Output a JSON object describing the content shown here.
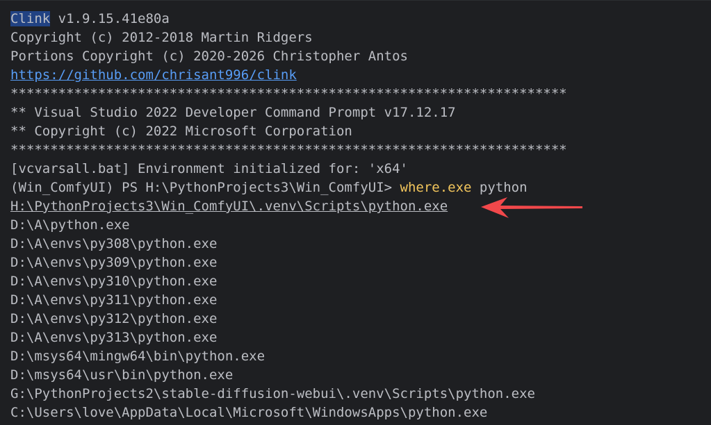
{
  "terminal": {
    "banner": {
      "clink_name": "Clink",
      "clink_version": " v1.9.15.41e80a",
      "copyright1": "Copyright (c) 2012-2018 Martin Ridgers",
      "copyright2": "Portions Copyright (c) 2020-2026 Christopher Antos",
      "url": "https://github.com/chrisant996/clink"
    },
    "separator": "**********************************************************************",
    "vs_title": "** Visual Studio 2022 Developer Command Prompt v17.12.17",
    "vs_copyright": "** Copyright (c) 2022 Microsoft Corporation",
    "vcvars": "[vcvarsall.bat] Environment initialized for: 'x64'",
    "prompt": "(Win_ComfyUI) PS H:\\PythonProjects3\\Win_ComfyUI> ",
    "command": "where.exe",
    "argument": " python",
    "results": [
      "H:\\PythonProjects3\\Win_ComfyUI\\.venv\\Scripts\\python.exe",
      "D:\\A\\python.exe",
      "D:\\A\\envs\\py308\\python.exe",
      "D:\\A\\envs\\py309\\python.exe",
      "D:\\A\\envs\\py310\\python.exe",
      "D:\\A\\envs\\py311\\python.exe",
      "D:\\A\\envs\\py312\\python.exe",
      "D:\\A\\envs\\py313\\python.exe",
      "D:\\msys64\\mingw64\\bin\\python.exe",
      "D:\\msys64\\usr\\bin\\python.exe",
      "G:\\PythonProjects2\\stable-diffusion-webui\\.venv\\Scripts\\python.exe",
      "C:\\Users\\love\\AppData\\Local\\Microsoft\\WindowsApps\\python.exe"
    ],
    "colors": {
      "background": "#1e1f22",
      "text": "#bcbec4",
      "link": "#589df6",
      "command": "#f2c55c",
      "selection": "#214283",
      "annotation_arrow": "#f2484b"
    }
  }
}
